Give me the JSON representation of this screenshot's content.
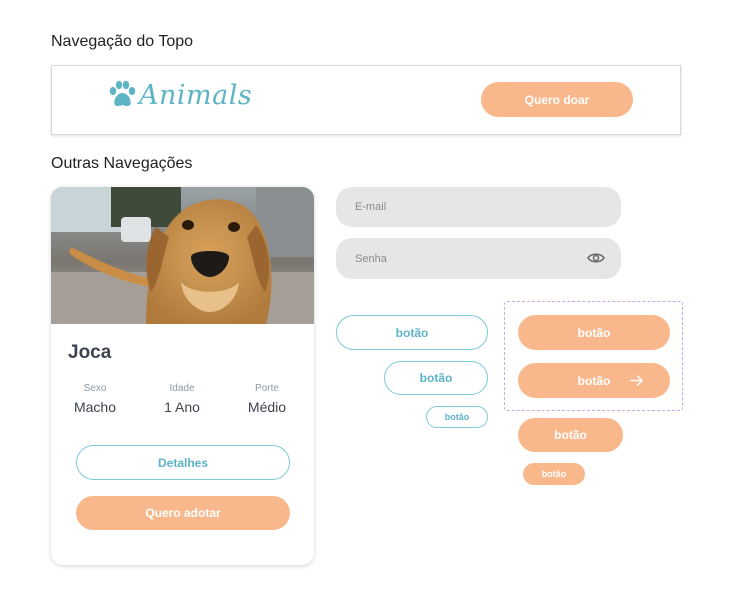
{
  "sections": {
    "top_nav_title": "Navegação do Topo",
    "other_nav_title": "Outras Navegações"
  },
  "topnav": {
    "logo_text": "Animals",
    "logo_icon": "paw-icon",
    "donate_button": "Quero doar"
  },
  "pet_card": {
    "name": "Joca",
    "attributes": [
      {
        "label": "Sexo",
        "value": "Macho"
      },
      {
        "label": "Idade",
        "value": "1 Ano"
      },
      {
        "label": "Porte",
        "value": "Médio"
      }
    ],
    "details_button": "Detalhes",
    "adopt_button": "Quero adotar"
  },
  "form": {
    "email_placeholder": "E-mail",
    "password_placeholder": "Senha",
    "eye_icon": "eye-icon"
  },
  "buttons": {
    "outline_large": "botão",
    "outline_medium": "botão",
    "outline_small": "botão",
    "filled_large": "botão",
    "filled_arrow": "botão",
    "filled_medium": "botão",
    "filled_small": "botão",
    "arrow_icon": "arrow-right-icon"
  },
  "colors": {
    "accent_orange": "#f8b88b",
    "accent_teal": "#5cb4c5",
    "input_bg": "#e6e6e6",
    "dashed_outline": "#c9a7f0"
  }
}
